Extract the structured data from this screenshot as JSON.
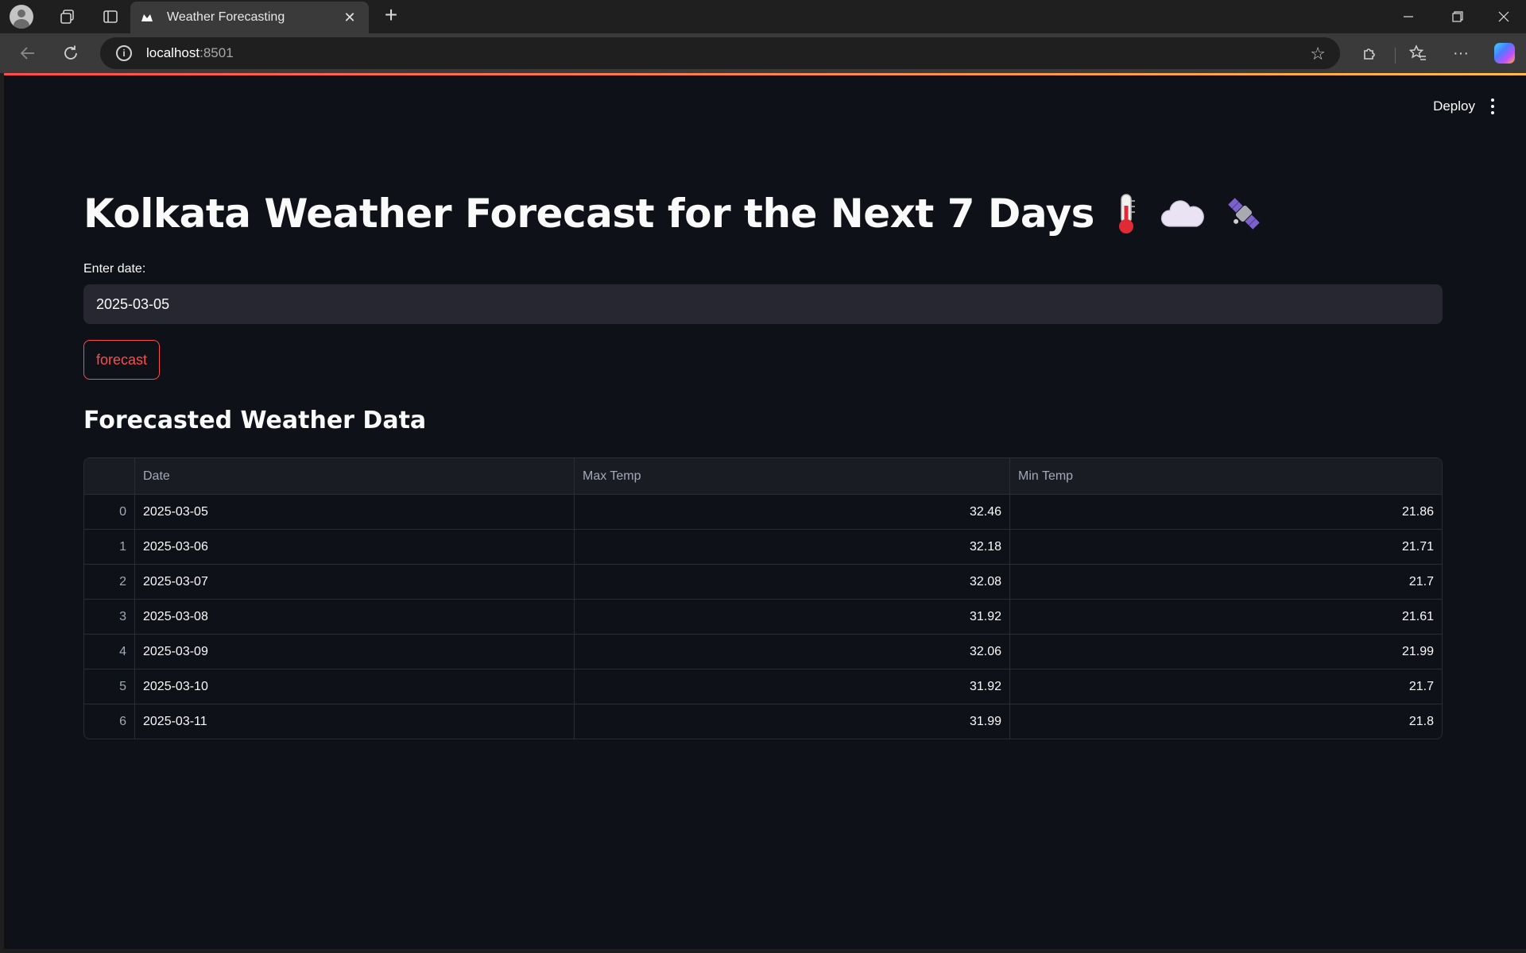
{
  "browser": {
    "tab_title": "Weather Forecasting",
    "url_host": "localhost",
    "url_port": ":8501"
  },
  "header": {
    "deploy_label": "Deploy"
  },
  "page": {
    "title": "Kolkata Weather Forecast for the Next 7 Days",
    "title_icons": [
      "thermometer-icon",
      "cloud-icon",
      "satellite-icon"
    ],
    "input_label": "Enter date:",
    "input_value": "2025-03-05",
    "button_label": "forecast",
    "section_title": "Forecasted Weather Data"
  },
  "table": {
    "columns": [
      "",
      "Date",
      "Max Temp",
      "Min Temp"
    ],
    "rows": [
      {
        "index": "0",
        "date": "2025-03-05",
        "max": "32.46",
        "min": "21.86"
      },
      {
        "index": "1",
        "date": "2025-03-06",
        "max": "32.18",
        "min": "21.71"
      },
      {
        "index": "2",
        "date": "2025-03-07",
        "max": "32.08",
        "min": "21.7"
      },
      {
        "index": "3",
        "date": "2025-03-08",
        "max": "31.92",
        "min": "21.61"
      },
      {
        "index": "4",
        "date": "2025-03-09",
        "max": "32.06",
        "min": "21.99"
      },
      {
        "index": "5",
        "date": "2025-03-10",
        "max": "31.92",
        "min": "21.7"
      },
      {
        "index": "6",
        "date": "2025-03-11",
        "max": "31.99",
        "min": "21.8"
      }
    ]
  },
  "colors": {
    "background": "#0e1117",
    "accent": "#ff4b4b",
    "input_bg": "#262730"
  }
}
